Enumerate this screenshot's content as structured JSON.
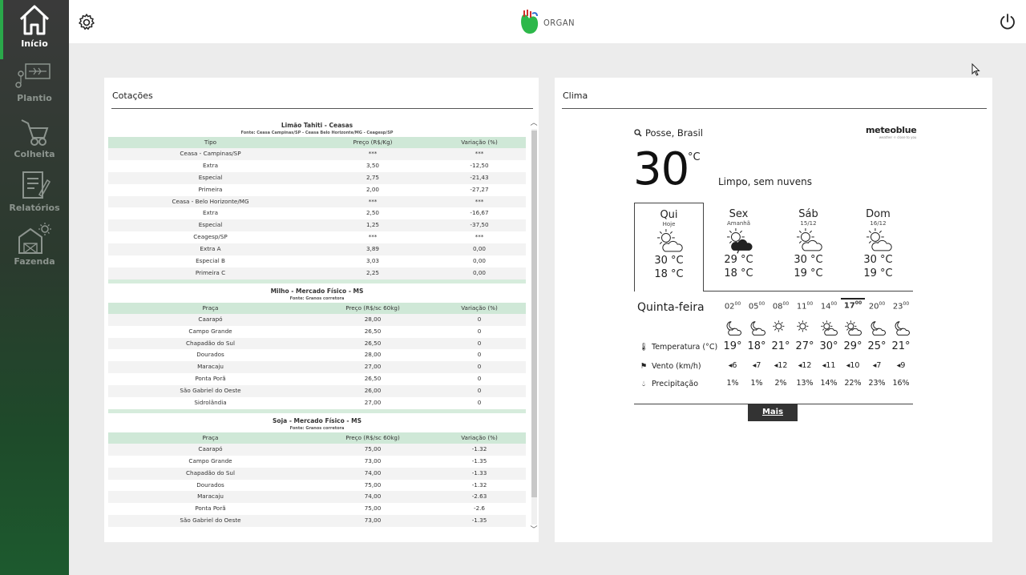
{
  "sidebar": {
    "items": [
      {
        "label": "Início",
        "icon": "home-icon",
        "active": true
      },
      {
        "label": "Plantio",
        "icon": "plant-icon"
      },
      {
        "label": "Colheita",
        "icon": "wheelbarrow-icon"
      },
      {
        "label": "Relatórios",
        "icon": "report-icon"
      },
      {
        "label": "Fazenda",
        "icon": "farm-icon"
      }
    ]
  },
  "header": {
    "logo_text": "ORGAN",
    "settings_icon": "gear-icon",
    "power_icon": "power-icon"
  },
  "cotacoes": {
    "title": "Cotações",
    "blocks": [
      {
        "title": "Limão Tahiti - Ceasas",
        "source": "Fonte: Ceasa Campinas/SP - Ceasa Belo Horizonte/MG - Ceagesp/SP",
        "headers": [
          "Tipo",
          "Preço (R$/Kg)",
          "Variação (%)"
        ],
        "rows": [
          [
            "Ceasa - Campinas/SP",
            "***",
            "***"
          ],
          [
            "Extra",
            "3,50",
            "-12,50"
          ],
          [
            "Especial",
            "2,75",
            "-21,43"
          ],
          [
            "Primeira",
            "2,00",
            "-27,27"
          ],
          [
            "Ceasa - Belo Horizonte/MG",
            "***",
            "***"
          ],
          [
            "Extra",
            "2,50",
            "-16,67"
          ],
          [
            "Especial",
            "1,25",
            "-37,50"
          ],
          [
            "Ceagesp/SP",
            "***",
            "***"
          ],
          [
            "Extra A",
            "3,89",
            "0,00"
          ],
          [
            "Especial B",
            "3,03",
            "0,00"
          ],
          [
            "Primeira C",
            "2,25",
            "0,00"
          ]
        ]
      },
      {
        "title": "Milho - Mercado Físico - MS",
        "source": "Fonte: Granos corretora",
        "headers": [
          "Praça",
          "Preço (R$/sc 60kg)",
          "Variação (%)"
        ],
        "rows": [
          [
            "Caarapó",
            "28,00",
            "0"
          ],
          [
            "Campo Grande",
            "26,50",
            "0"
          ],
          [
            "Chapadão do Sul",
            "26,50",
            "0"
          ],
          [
            "Dourados",
            "28,00",
            "0"
          ],
          [
            "Maracaju",
            "27,00",
            "0"
          ],
          [
            "Ponta Porã",
            "26,50",
            "0"
          ],
          [
            "São Gabriel do Oeste",
            "26,00",
            "0"
          ],
          [
            "Sidrolândia",
            "27,00",
            "0"
          ]
        ]
      },
      {
        "title": "Soja - Mercado Físico - MS",
        "source": "Fonte: Granos corretora",
        "headers": [
          "Praça",
          "Preço (R$/sc 60kg)",
          "Variação (%)"
        ],
        "rows": [
          [
            "Caarapó",
            "75,00",
            "-1.32"
          ],
          [
            "Campo Grande",
            "73,00",
            "-1.35"
          ],
          [
            "Chapadão do Sul",
            "74,00",
            "-1.33"
          ],
          [
            "Dourados",
            "75,00",
            "-1.32"
          ],
          [
            "Maracaju",
            "74,00",
            "-2.63"
          ],
          [
            "Ponta Porã",
            "75,00",
            "-2.6"
          ],
          [
            "São Gabriel do Oeste",
            "73,00",
            "-1.35"
          ]
        ]
      }
    ]
  },
  "clima": {
    "title": "Clima",
    "location": "Posse, Brasil",
    "brand": "meteoblue",
    "brand_tagline": "weather ☼ close to you",
    "current_temp": "30",
    "unit": "°C",
    "condition": "Limpo, sem nuvens",
    "days": [
      {
        "name": "Qui",
        "date": "Hoje",
        "icon": "sun-cloud-icon",
        "max": "30 °C",
        "min": "18 °C",
        "selected": true
      },
      {
        "name": "Sex",
        "date": "Amanhã",
        "icon": "thunderstorm-icon",
        "max": "29 °C",
        "min": "18 °C"
      },
      {
        "name": "Sáb",
        "date": "15/12",
        "icon": "sun-cloud-icon",
        "max": "30 °C",
        "min": "19 °C"
      },
      {
        "name": "Dom",
        "date": "16/12",
        "icon": "sun-cloud-icon",
        "max": "30 °C",
        "min": "19 °C"
      }
    ],
    "weekday": "Quinta-feira",
    "hours": [
      {
        "h": "02",
        "icon": "moon-cloud-icon",
        "temp": "19°",
        "wind": "6",
        "prec": "1%"
      },
      {
        "h": "05",
        "icon": "moon-cloud-icon",
        "temp": "18°",
        "wind": "7",
        "prec": "1%"
      },
      {
        "h": "08",
        "icon": "sun-icon",
        "temp": "21°",
        "wind": "12",
        "prec": "2%"
      },
      {
        "h": "11",
        "icon": "sun-icon",
        "temp": "27°",
        "wind": "12",
        "prec": "13%"
      },
      {
        "h": "14",
        "icon": "sun-cloud-icon",
        "temp": "30°",
        "wind": "11",
        "prec": "14%"
      },
      {
        "h": "17",
        "icon": "sun-cloud-icon",
        "temp": "29°",
        "wind": "10",
        "prec": "22%",
        "current": true
      },
      {
        "h": "20",
        "icon": "moon-cloud-icon",
        "temp": "25°",
        "wind": "7",
        "prec": "23%"
      },
      {
        "h": "23",
        "icon": "moon-cloud-icon",
        "temp": "21°",
        "wind": "9",
        "prec": "16%"
      }
    ],
    "minutes_sup": "00",
    "labels": {
      "temp": "Temperatura (°C)",
      "wind": "Vento (km/h)",
      "prec": "Precipitação"
    },
    "more_label": "Mais"
  }
}
